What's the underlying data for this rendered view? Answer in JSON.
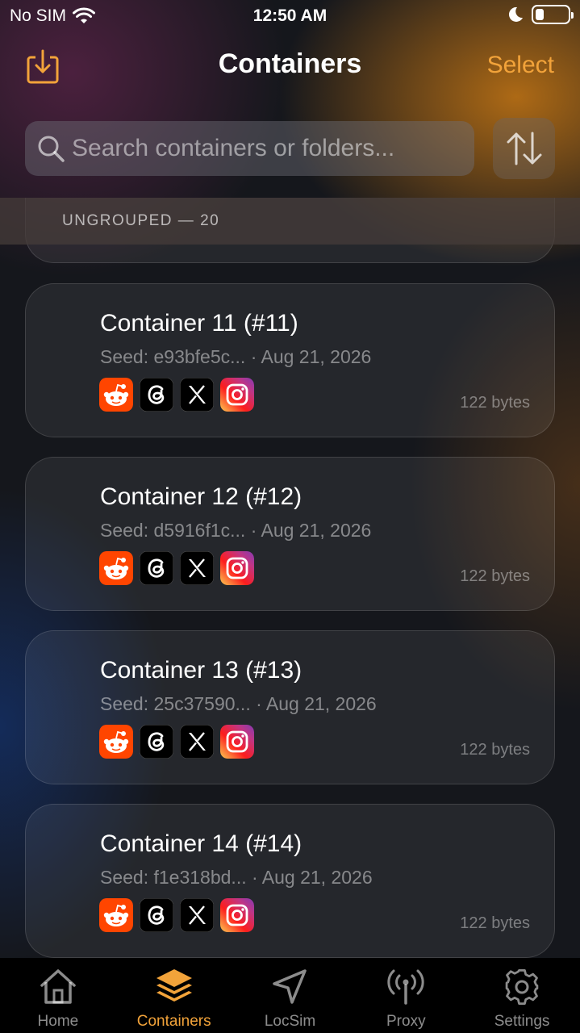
{
  "status_bar": {
    "carrier": "No SIM",
    "time": "12:50 AM"
  },
  "header": {
    "title": "Containers",
    "select_label": "Select",
    "import_icon": "tray-arrow-down-icon"
  },
  "search": {
    "placeholder": "Search containers or folders..."
  },
  "section": {
    "label": "UNGROUPED — 20"
  },
  "containers": [
    {
      "title": "Container 11 (#11)",
      "meta": "Seed: e93bfe5c... · Aug 21, 2026",
      "size": "122 bytes"
    },
    {
      "title": "Container 12 (#12)",
      "meta": "Seed: d5916f1c... · Aug 21, 2026",
      "size": "122 bytes"
    },
    {
      "title": "Container 13 (#13)",
      "meta": "Seed: 25c37590... · Aug 21, 2026",
      "size": "122 bytes"
    },
    {
      "title": "Container 14 (#14)",
      "meta": "Seed: f1e318bd... · Aug 21, 2026",
      "size": "122 bytes"
    }
  ],
  "app_icons": [
    "reddit-icon",
    "threads-icon",
    "x-icon",
    "instagram-icon"
  ],
  "tabs": [
    {
      "label": "Home",
      "icon": "house-icon"
    },
    {
      "label": "Containers",
      "icon": "stack-icon"
    },
    {
      "label": "LocSim",
      "icon": "location-arrow-icon"
    },
    {
      "label": "Proxy",
      "icon": "antenna-icon"
    },
    {
      "label": "Settings",
      "icon": "gear-icon"
    }
  ],
  "colors": {
    "accent": "#f2a33a",
    "reddit": "#ff4500",
    "threads": "#000000",
    "x": "#000000"
  }
}
